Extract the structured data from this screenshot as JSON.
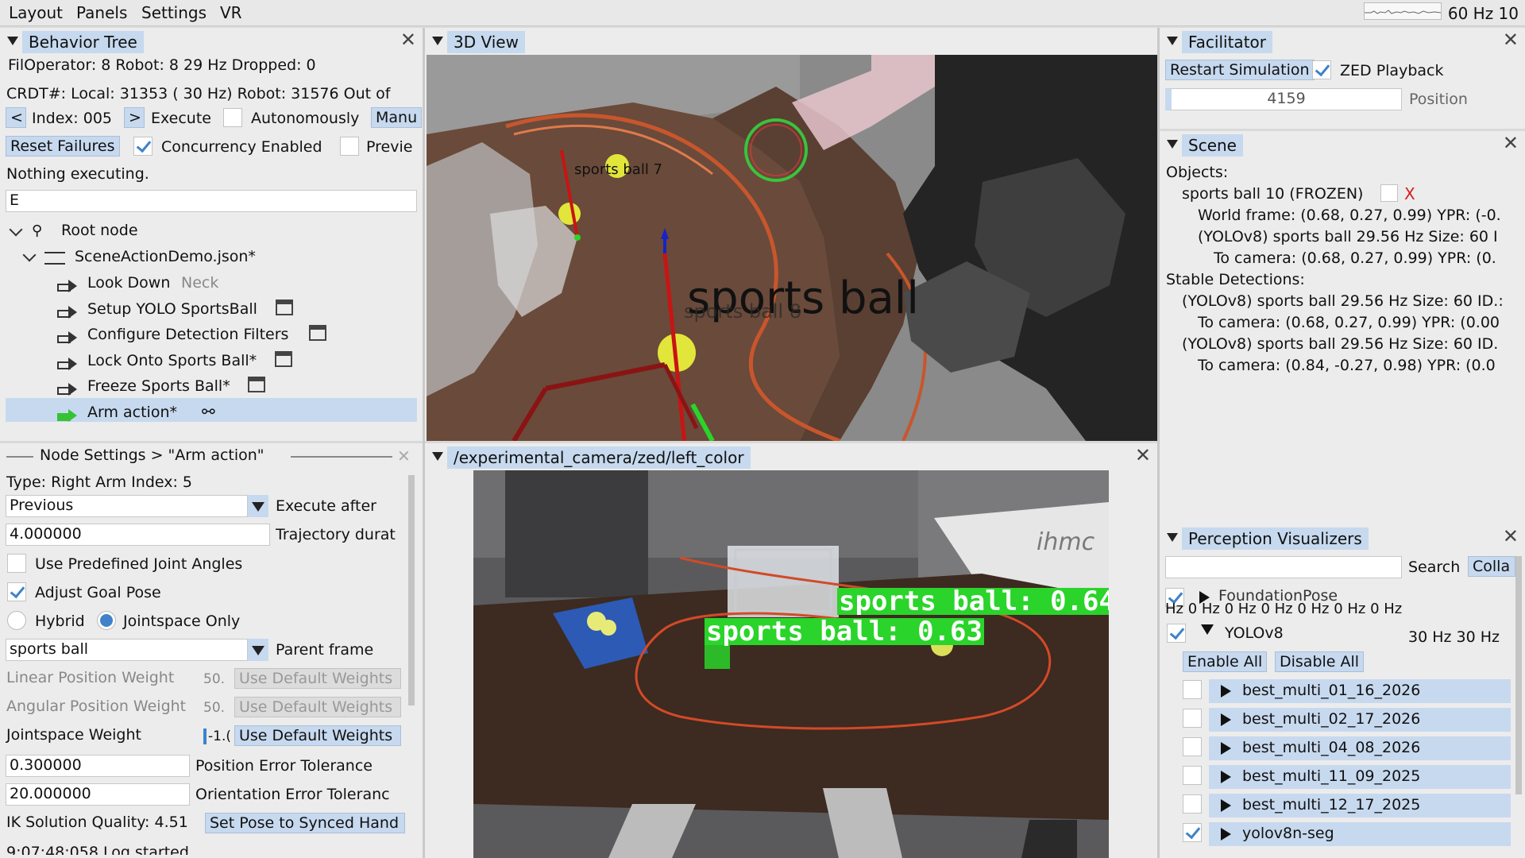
{
  "menubar": {
    "items": [
      "Layout",
      "Panels",
      "Settings",
      "VR"
    ],
    "fps": "60 Hz 10"
  },
  "behavior_tree": {
    "title": "Behavior Tree",
    "status_line": "FilOperator: 8 Robot: 8 29 Hz Dropped: 0",
    "crdt_line": "CRDT#: Local: 31353 ( 30 Hz) Robot: 31576 Out of",
    "index_prev": "<",
    "index_label": "Index: 005",
    "index_next": ">",
    "execute": "Execute",
    "autonomously": "Autonomously",
    "manual": "Manu",
    "reset_failures": "Reset Failures",
    "concurrency": "Concurrency Enabled",
    "preview": "Previe",
    "status": "Nothing executing.",
    "filter_value": "E",
    "tree": [
      "Root node",
      "SceneActionDemo.json*",
      "Look Down",
      "Neck",
      "Setup YOLO SportsBall",
      "Configure Detection Filters",
      "Lock Onto Sports Ball*",
      "Freeze Sports Ball*",
      "Arm action*"
    ]
  },
  "node_settings": {
    "title": "Node Settings > \"Arm action\"",
    "type_line": "Type: Right Arm  Index: 5",
    "execute_after_value": "Previous",
    "execute_after_label": "Execute after",
    "trajectory_value": "4.000000",
    "trajectory_label": "Trajectory durat",
    "use_predefined": "Use Predefined Joint Angles",
    "adjust_goal": "Adjust Goal Pose",
    "hybrid": "Hybrid",
    "jointspace_only": "Jointspace Only",
    "parent_frame_value": "sports ball",
    "parent_frame_label": "Parent frame",
    "linear_weight": "Linear Position Weight",
    "linear_value": "50.",
    "angular_weight": "Angular Position Weight",
    "angular_value": "50.",
    "jointspace_weight": "Jointspace Weight",
    "jointspace_value": "-1.(",
    "use_default": "Use Default Weights",
    "pos_tol_value": "0.300000",
    "pos_tol_label": "Position Error Tolerance",
    "ori_tol_value": "20.000000",
    "ori_tol_label": "Orientation Error Toleranc",
    "ik_quality": "IK Solution Quality: 4.51",
    "set_pose": "Set Pose to Synced Hand",
    "log_line": "9:07:48:058 Log started"
  },
  "view3d": {
    "title": "3D View",
    "big_label": "sports ball",
    "small_label": "sports ball 7",
    "shadow_label": "sports ball 8"
  },
  "camera": {
    "title": "/experimental_camera/zed/left_color",
    "det1": "sports ball: 0.64",
    "det2": "sports ball: 0.63",
    "banner": "ihmc"
  },
  "facilitator": {
    "title": "Facilitator",
    "restart": "Restart Simulation",
    "zed_playback": "ZED Playback",
    "position_value": "4159",
    "position_label": "Position"
  },
  "scene": {
    "title": "Scene",
    "lines": [
      "Objects:",
      "sports ball 10 (FROZEN)",
      "World frame: (0.68, 0.27, 0.99) YPR: (-0.",
      "(YOLOv8) sports ball 29.56 Hz Size: 60 I",
      "To camera: (0.68, 0.27, 0.99) YPR: (0.",
      "Stable Detections:",
      "(YOLOv8) sports ball 29.56 Hz Size: 60 ID.:",
      "To camera: (0.68, 0.27, 0.99) YPR: (0.00",
      "(YOLOv8) sports ball 29.56 Hz Size: 60 ID.",
      "To camera: (0.84, -0.27, 0.98) YPR: (0.0"
    ],
    "x_mark": "X"
  },
  "perception": {
    "title": "Perception Visualizers",
    "search": "Search",
    "collapse": "Colla",
    "foundation": "FoundationPose",
    "hz_row": "Hz 0 Hz 0 Hz 0 Hz 0 Hz 0 Hz 0 Hz",
    "yolo": "YOLOv8",
    "yolo_hz": "30 Hz 30 Hz",
    "enable_all": "Enable All",
    "disable_all": "Disable All",
    "models": [
      "best_multi_01_16_2026",
      "best_multi_02_17_2026",
      "best_multi_04_08_2026",
      "best_multi_11_09_2025",
      "best_multi_12_17_2025",
      "yolov8n-seg"
    ]
  }
}
